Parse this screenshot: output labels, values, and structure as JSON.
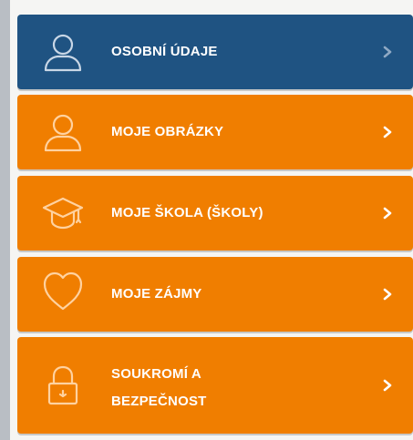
{
  "menu": {
    "items": [
      {
        "label": "OSOBNÍ ÚDAJE",
        "icon": "person-icon",
        "active": true
      },
      {
        "label": "MOJE OBRÁZKY",
        "icon": "person-icon",
        "active": false
      },
      {
        "label": "MOJE ŠKOLA (ŠKOLY)",
        "icon": "graduation-cap-icon",
        "active": false
      },
      {
        "label": "MOJE ZÁJMY",
        "icon": "heart-icon",
        "active": false
      },
      {
        "label_line1": "SOUKROMÍ A",
        "label_line2": "BEZPEČNOST",
        "icon": "lock-icon",
        "active": false
      }
    ]
  },
  "colors": {
    "active_bg": "#1f5382",
    "item_bg": "#f07e00",
    "text": "#ffffff"
  }
}
